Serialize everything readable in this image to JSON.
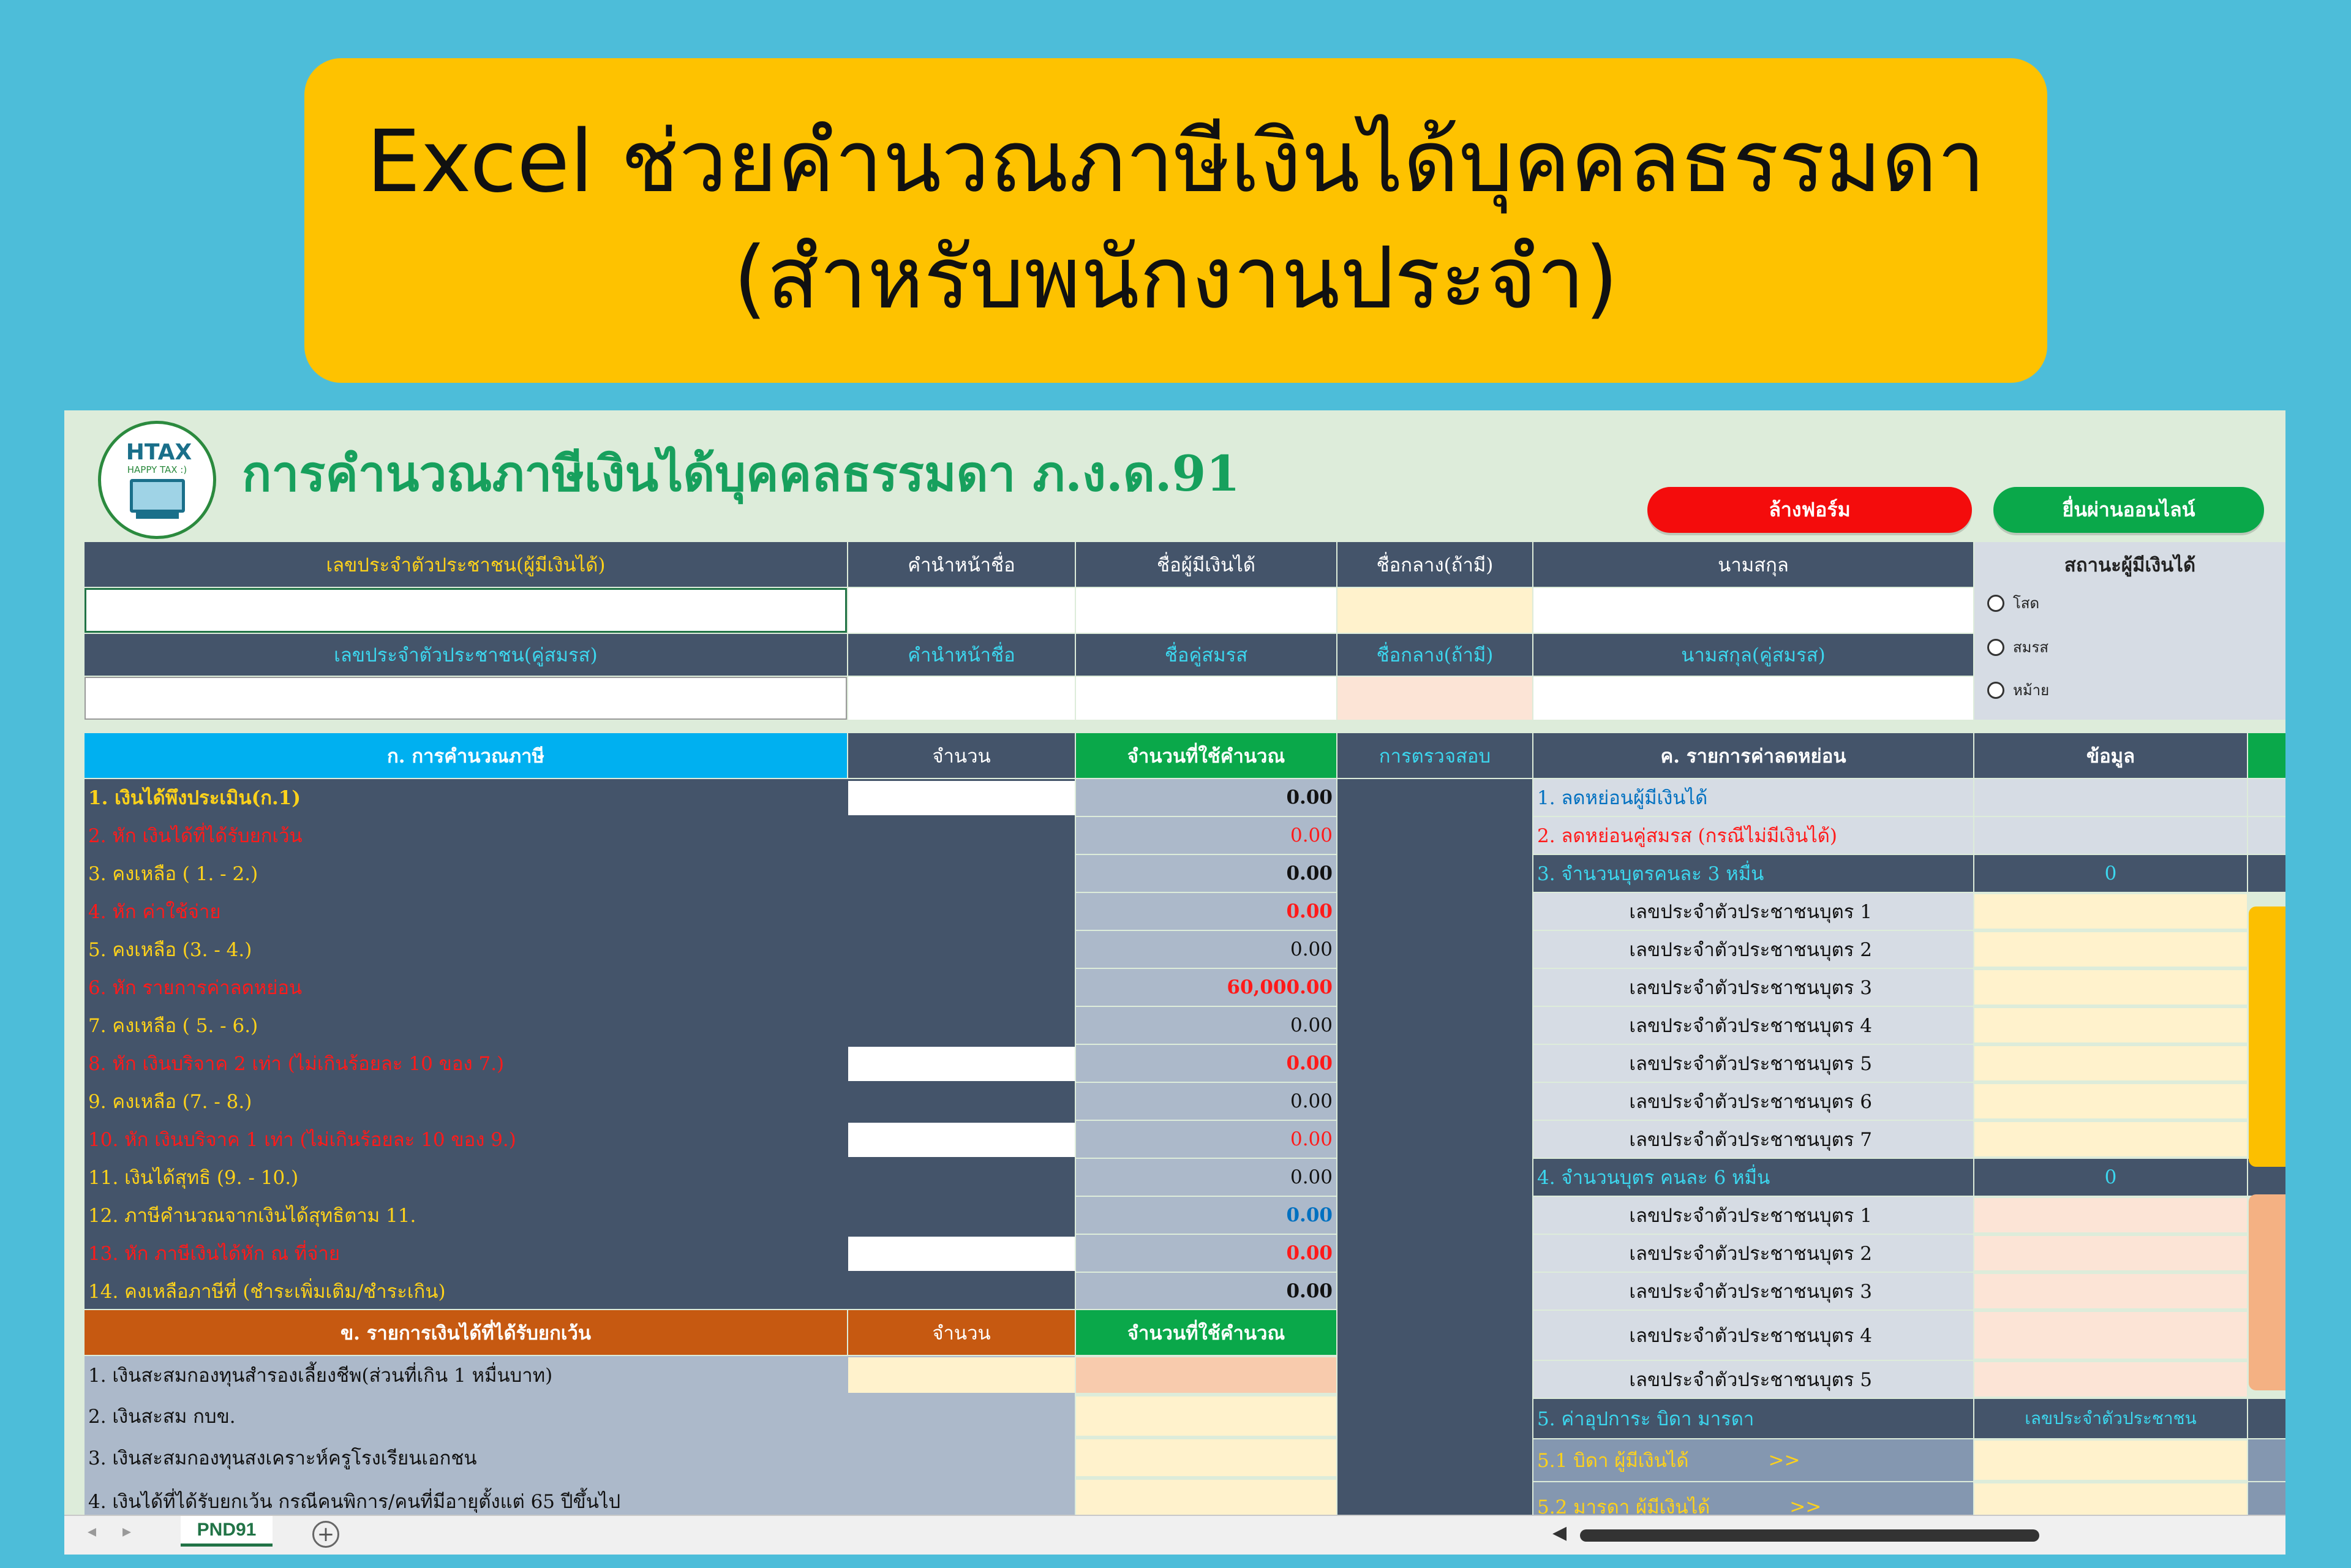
{
  "banner": {
    "line1": "Excel ช่วยคำนวณภาษีเงินได้บุคคลธรรมดา",
    "line2": "(สำหรับพนักงานประจำ)"
  },
  "logo": {
    "text": "HTAX",
    "subtitle": "HAPPY TAX :)"
  },
  "sheet_title": "การคำนวณภาษีเงินได้บุคคลธรรมดา ภ.ง.ด.91",
  "buttons": {
    "clear": "ล้างฟอร์ม",
    "submit": "ยื่นผ่านออนไลน์"
  },
  "taxpayer": {
    "id_label": "เลขประจำตัวประชาชน(ผู้มีเงินได้)",
    "prefix_label": "คำนำหน้าชื่อ",
    "name_label": "ชื่อผู้มีเงินได้",
    "middle_label": "ชื่อกลาง(ถ้ามี)",
    "surname_label": "นามสกุล"
  },
  "spouse": {
    "id_label": "เลขประจำตัวประชาชน(คู่สมรส)",
    "prefix_label": "คำนำหน้าชื่อ",
    "name_label": "ชื่อคู่สมรส",
    "middle_label": "ชื่อกลาง(ถ้ามี)",
    "surname_label": "นามสกุล(คู่สมรส)"
  },
  "status": {
    "label": "สถานะผู้มีเงินได้",
    "options": [
      "โสด",
      "สมรส",
      "หม้าย"
    ]
  },
  "calc_section": {
    "header": "ก. การคำนวณภาษี",
    "amount_header": "จำนวน",
    "used_header": "จำนวนที่ใช้คำนวณ",
    "check_header": "การตรวจสอบ",
    "rows": [
      {
        "label": "1. เงินได้พึงประเมิน(ก.1)",
        "value": "0.00"
      },
      {
        "label": "2. หัก เงินได้ที่ได้รับยกเว้น",
        "value": "0.00"
      },
      {
        "label": "3. คงเหลือ ( 1. - 2.)",
        "value": "0.00"
      },
      {
        "label": "4. หัก ค่าใช้จ่าย",
        "value": "0.00"
      },
      {
        "label": "5. คงเหลือ (3. - 4.)",
        "value": "0.00"
      },
      {
        "label": "6. หัก รายการค่าลดหย่อน",
        "value": "60,000.00"
      },
      {
        "label": "7. คงเหลือ ( 5. - 6.)",
        "value": "0.00"
      },
      {
        "label": "8. หัก เงินบริจาค 2 เท่า (ไม่เกินร้อยละ 10 ของ 7.)",
        "value": "0.00"
      },
      {
        "label": "9. คงเหลือ (7. - 8.)",
        "value": "0.00"
      },
      {
        "label": "10. หัก เงินบริจาค 1 เท่า (ไม่เกินร้อยละ 10 ของ 9.)",
        "value": "0.00"
      },
      {
        "label": "11. เงินได้สุทธิ (9. - 10.)",
        "value": "0.00"
      },
      {
        "label": "12. ภาษีคำนวณจากเงินได้สุทธิตาม 11.",
        "value": "0.00"
      },
      {
        "label": "13. หัก ภาษีเงินได้หัก ณ ที่จ่าย",
        "value": "0.00"
      },
      {
        "label": "14. คงเหลือภาษีที่ (ชำระเพิ่มเติม/ชำระเกิน)",
        "value": "0.00"
      }
    ]
  },
  "exempt_section": {
    "header": "ข. รายการเงินได้ที่ได้รับยกเว้น",
    "amount_header": "จำนวน",
    "used_header": "จำนวนที่ใช้คำนวณ",
    "rows": [
      "1. เงินสะสมกองทุนสำรองเลี้ยงชีพ(ส่วนที่เกิน 1 หมื่นบาท)",
      "2. เงินสะสม กบข.",
      "3. เงินสะสมกองทุนสงเคราะห์ครูโรงเรียนเอกชน",
      "4. เงินได้ที่ได้รับยกเว้น กรณีคนพิการ/คนที่มีอายุตั้งแต่ 65 ปีขึ้นไป"
    ]
  },
  "deduction_section": {
    "header": "ค. รายการค่าลดหย่อน",
    "data_header": "ข้อมูล",
    "row1": "1. ลดหย่อนผู้มีเงินได้",
    "row2": "2. ลดหย่อนคู่สมรส (กรณีไม่มีเงินได้)",
    "row3": "3. จำนวนบุตรคนละ 3 หมื่น",
    "row3_value": "0",
    "children_a": [
      "เลขประจำตัวประชาชนบุตร 1",
      "เลขประจำตัวประชาชนบุตร 2",
      "เลขประจำตัวประชาชนบุตร 3",
      "เลขประจำตัวประชาชนบุตร 4",
      "เลขประจำตัวประชาชนบุตร 5",
      "เลขประจำตัวประชาชนบุตร 6",
      "เลขประจำตัวประชาชนบุตร 7"
    ],
    "row4": "4. จำนวนบุตร คนละ 6 หมื่น",
    "row4_value": "0",
    "children_b": [
      "เลขประจำตัวประชาชนบุตร 1",
      "เลขประจำตัวประชาชนบุตร 2",
      "เลขประจำตัวประชาชนบุตร 3",
      "เลขประจำตัวประชาชนบุตร 4",
      "เลขประจำตัวประชาชนบุตร 5"
    ],
    "row5": "5. ค่าอุปการะ บิดา มารดา",
    "row5_value": "เลขประจำตัวประชาชน",
    "row51": "5.1 บิดา ผู้มีเงินได้",
    "row51_arrow": ">>",
    "row52": "5.2 มารดา ผู้มีเงินได้",
    "row52_arrow": ">>"
  },
  "sheet_tab": "PND91",
  "colors": {
    "background": "#4dbdd9",
    "banner": "#fec200",
    "header": "#44546a",
    "title_green": "#17a05d"
  }
}
